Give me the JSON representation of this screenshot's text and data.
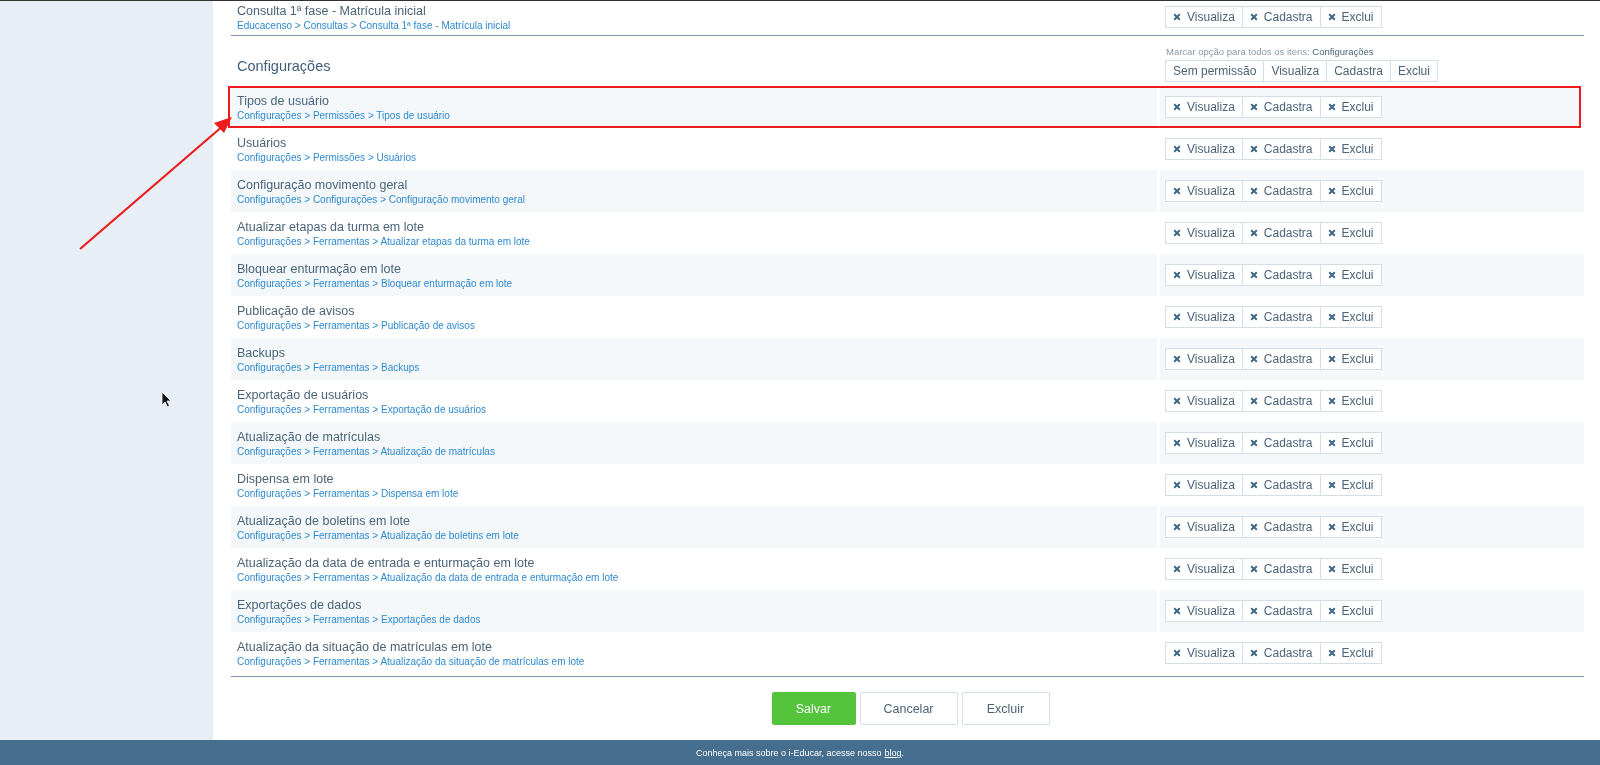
{
  "top_row": {
    "title": "Consulta 1ª fase - Matrícula inicial",
    "path": "Educacenso > Consultas > Consulta 1ª fase - Matrícula inicial",
    "permissions": [
      {
        "label": "Visualiza",
        "checked": false
      },
      {
        "label": "Cadastra",
        "checked": false
      },
      {
        "label": "Exclui",
        "checked": false
      }
    ]
  },
  "section": {
    "title": "Configurações",
    "bulk_label": "Marcar opção para todos os itens:",
    "bulk_target": "Configurações",
    "bulk_options": [
      "Sem permissão",
      "Visualiza",
      "Cadastra",
      "Exclui"
    ]
  },
  "rows": [
    {
      "title": "Tipos de usuário",
      "path": "Configurações > Permissões > Tipos de usuário",
      "annotated": true,
      "permissions": [
        {
          "label": "Visualiza",
          "checked": false
        },
        {
          "label": "Cadastra",
          "checked": false
        },
        {
          "label": "Exclui",
          "checked": false
        }
      ]
    },
    {
      "title": "Usuários",
      "path": "Configurações > Permissões > Usuários",
      "annotated": false,
      "permissions": [
        {
          "label": "Visualiza",
          "checked": false
        },
        {
          "label": "Cadastra",
          "checked": false
        },
        {
          "label": "Exclui",
          "checked": false
        }
      ]
    },
    {
      "title": "Configuração movimento geral",
      "path": "Configurações > Configurações > Configuração movimento geral",
      "annotated": false,
      "permissions": [
        {
          "label": "Visualiza",
          "checked": false
        },
        {
          "label": "Cadastra",
          "checked": false
        },
        {
          "label": "Exclui",
          "checked": false
        }
      ]
    },
    {
      "title": "Atualizar etapas da turma em lote",
      "path": "Configurações > Ferramentas > Atualizar etapas da turma em lote",
      "annotated": false,
      "permissions": [
        {
          "label": "Visualiza",
          "checked": false
        },
        {
          "label": "Cadastra",
          "checked": false
        },
        {
          "label": "Exclui",
          "checked": false
        }
      ]
    },
    {
      "title": "Bloquear enturmação em lote",
      "path": "Configurações > Ferramentas > Bloquear enturmação em lote",
      "annotated": false,
      "permissions": [
        {
          "label": "Visualiza",
          "checked": false
        },
        {
          "label": "Cadastra",
          "checked": false
        },
        {
          "label": "Exclui",
          "checked": false
        }
      ]
    },
    {
      "title": "Publicação de avisos",
      "path": "Configurações > Ferramentas > Publicação de avisos",
      "annotated": false,
      "permissions": [
        {
          "label": "Visualiza",
          "checked": false
        },
        {
          "label": "Cadastra",
          "checked": false
        },
        {
          "label": "Exclui",
          "checked": false
        }
      ]
    },
    {
      "title": "Backups",
      "path": "Configurações > Ferramentas > Backups",
      "annotated": false,
      "permissions": [
        {
          "label": "Visualiza",
          "checked": false
        },
        {
          "label": "Cadastra",
          "checked": false
        },
        {
          "label": "Exclui",
          "checked": false
        }
      ]
    },
    {
      "title": "Exportação de usuários",
      "path": "Configurações > Ferramentas > Exportação de usuários",
      "annotated": false,
      "permissions": [
        {
          "label": "Visualiza",
          "checked": false
        },
        {
          "label": "Cadastra",
          "checked": false
        },
        {
          "label": "Exclui",
          "checked": false
        }
      ]
    },
    {
      "title": "Atualização de matrículas",
      "path": "Configurações > Ferramentas > Atualização de matrículas",
      "annotated": false,
      "permissions": [
        {
          "label": "Visualiza",
          "checked": false
        },
        {
          "label": "Cadastra",
          "checked": false
        },
        {
          "label": "Exclui",
          "checked": false
        }
      ]
    },
    {
      "title": "Dispensa em lote",
      "path": "Configurações > Ferramentas > Dispensa em lote",
      "annotated": false,
      "permissions": [
        {
          "label": "Visualiza",
          "checked": false
        },
        {
          "label": "Cadastra",
          "checked": false
        },
        {
          "label": "Exclui",
          "checked": false
        }
      ]
    },
    {
      "title": "Atualização de boletins em lote",
      "path": "Configurações > Ferramentas > Atualização de boletins em lote",
      "annotated": false,
      "permissions": [
        {
          "label": "Visualiza",
          "checked": false
        },
        {
          "label": "Cadastra",
          "checked": false
        },
        {
          "label": "Exclui",
          "checked": false
        }
      ]
    },
    {
      "title": "Atualização da data de entrada e enturmação em lote",
      "path": "Configurações > Ferramentas > Atualização da data de entrada e enturmação em lote",
      "annotated": false,
      "permissions": [
        {
          "label": "Visualiza",
          "checked": false
        },
        {
          "label": "Cadastra",
          "checked": false
        },
        {
          "label": "Exclui",
          "checked": false
        }
      ]
    },
    {
      "title": "Exportações de dados",
      "path": "Configurações > Ferramentas > Exportações de dados",
      "annotated": false,
      "permissions": [
        {
          "label": "Visualiza",
          "checked": false
        },
        {
          "label": "Cadastra",
          "checked": false
        },
        {
          "label": "Exclui",
          "checked": false
        }
      ]
    },
    {
      "title": "Atualização da situação de matrículas em lote",
      "path": "Configurações > Ferramentas > Atualização da situação de matrículas em lote",
      "annotated": false,
      "permissions": [
        {
          "label": "Visualiza",
          "checked": false
        },
        {
          "label": "Cadastra",
          "checked": false
        },
        {
          "label": "Exclui",
          "checked": false
        }
      ]
    }
  ],
  "actions": [
    {
      "label": "Salvar",
      "kind": "primary"
    },
    {
      "label": "Cancelar",
      "kind": "secondary"
    },
    {
      "label": "Excluir",
      "kind": "secondary"
    }
  ],
  "footer": {
    "text": "Conheça mais sobre o i-Educar, acesse nosso",
    "link": "blog",
    "end": "."
  }
}
